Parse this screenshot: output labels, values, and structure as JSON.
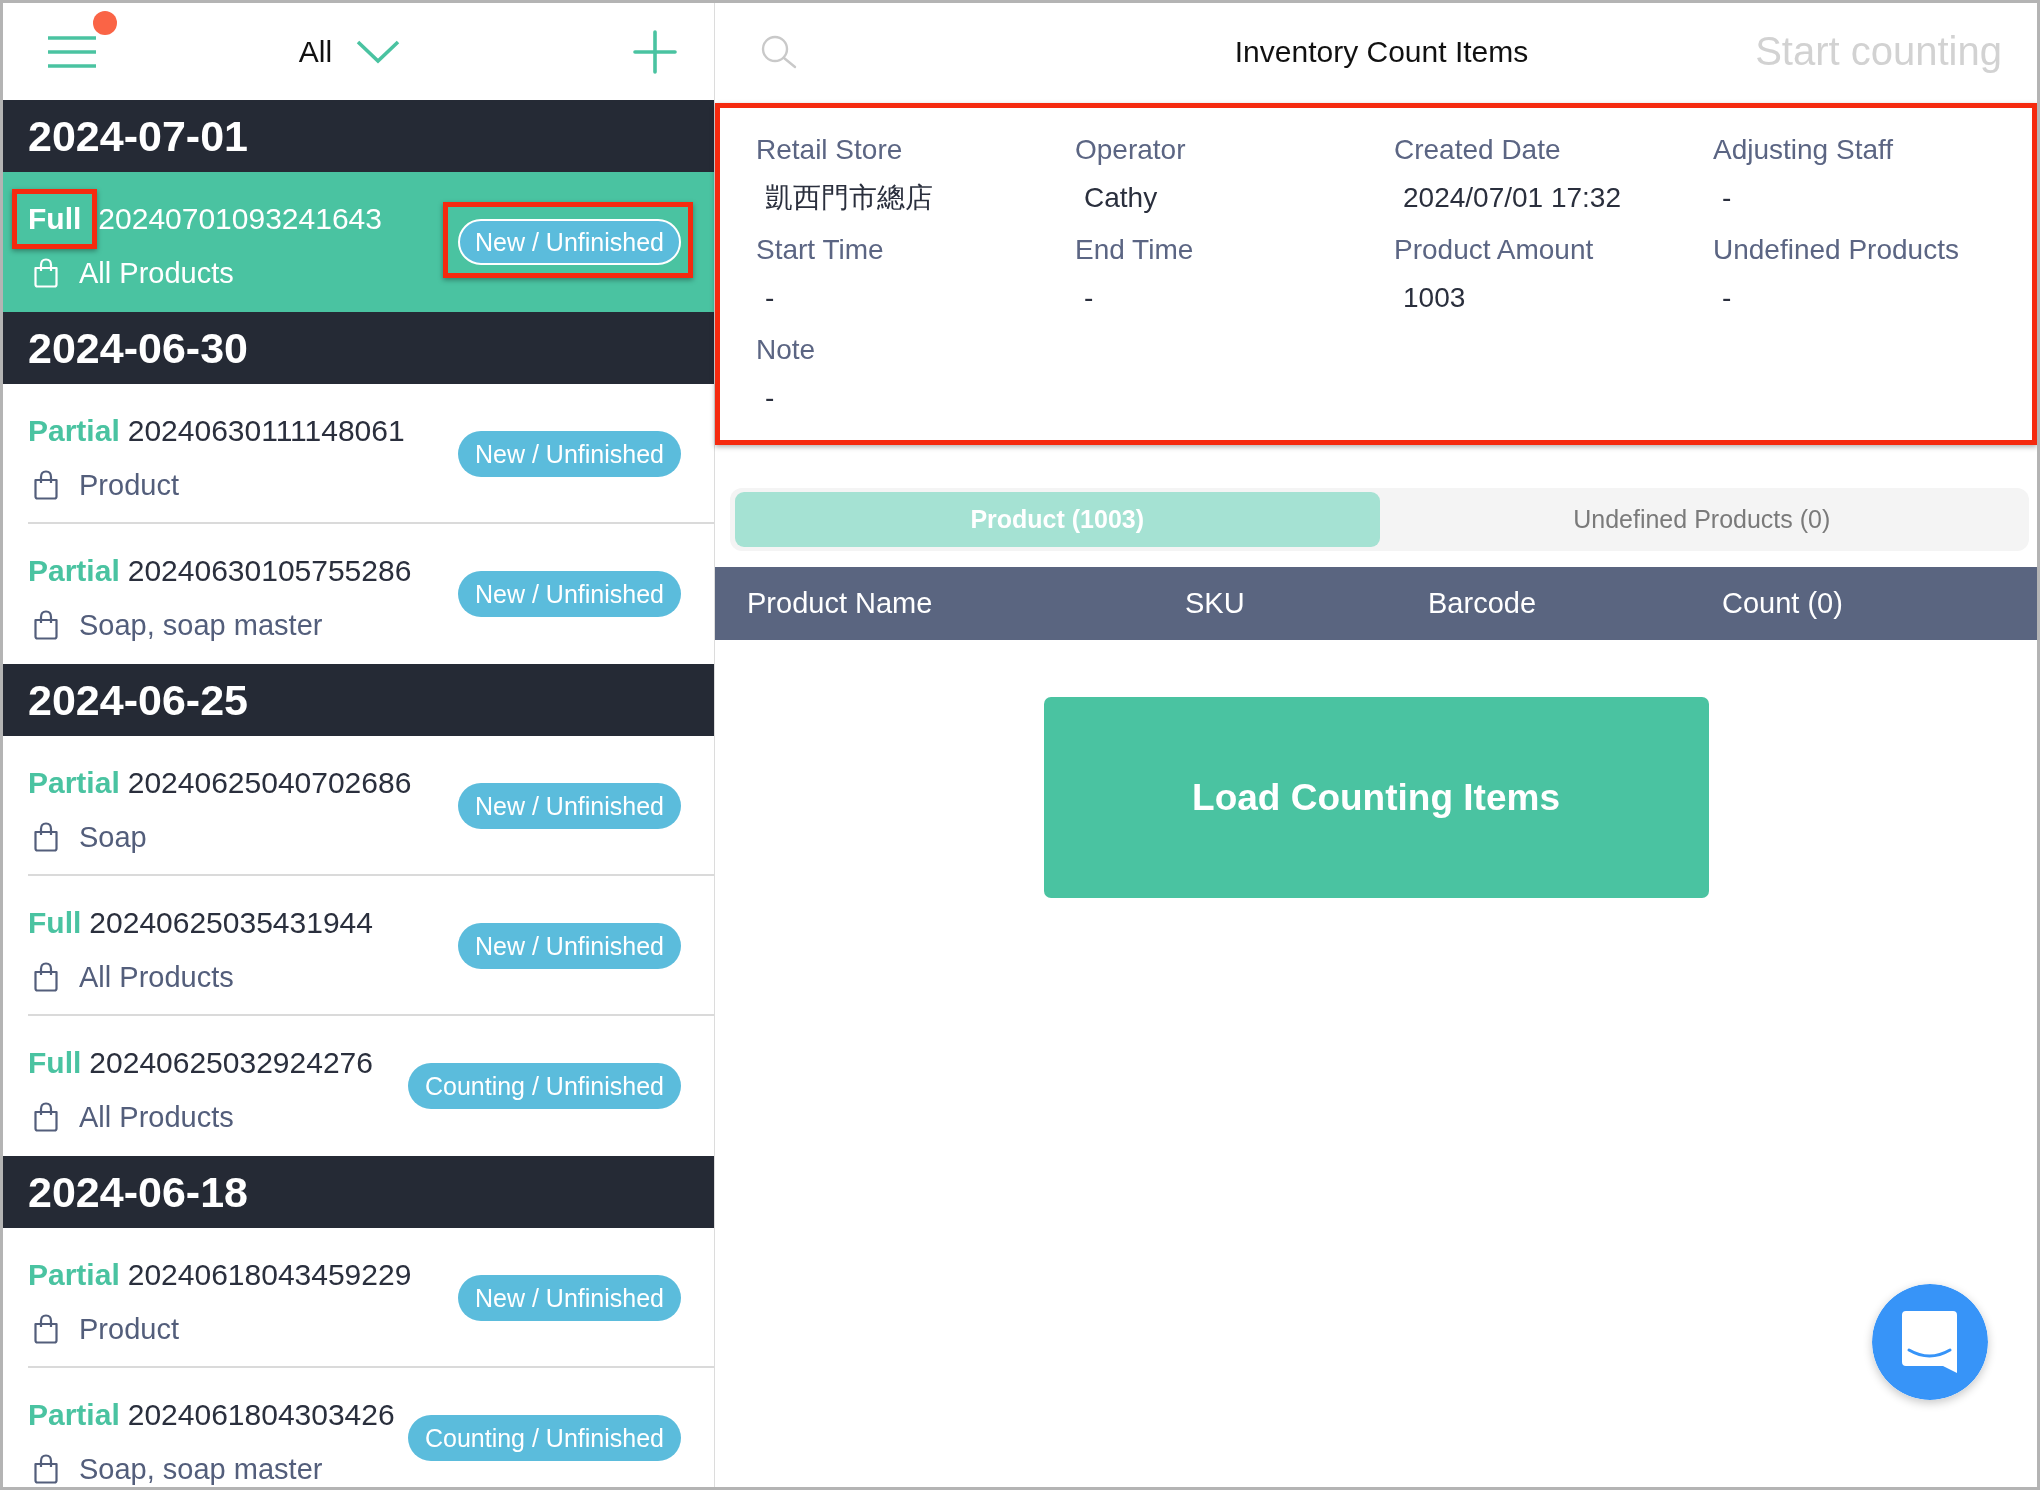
{
  "sidebar": {
    "menu": {
      "notification": true
    },
    "filter": {
      "label": "All"
    },
    "groups": [
      {
        "date": "2024-07-01",
        "items": [
          {
            "type": "Full",
            "number": "20240701093241643",
            "scope": "All Products",
            "status": "New / Unfinished",
            "selected": true,
            "type_highlighted": true,
            "status_highlighted": true
          }
        ]
      },
      {
        "date": "2024-06-30",
        "items": [
          {
            "type": "Partial",
            "number": "20240630111148061",
            "scope": "Product",
            "status": "New / Unfinished",
            "selected": false,
            "type_highlighted": false,
            "status_highlighted": false
          },
          {
            "type": "Partial",
            "number": "20240630105755286",
            "scope": "Soap, soap master",
            "status": "New / Unfinished",
            "selected": false,
            "type_highlighted": false,
            "status_highlighted": false
          }
        ]
      },
      {
        "date": "2024-06-25",
        "items": [
          {
            "type": "Partial",
            "number": "20240625040702686",
            "scope": "Soap",
            "status": "New / Unfinished",
            "selected": false,
            "type_highlighted": false,
            "status_highlighted": false
          },
          {
            "type": "Full",
            "number": "20240625035431944",
            "scope": "All Products",
            "status": "New / Unfinished",
            "selected": false,
            "type_highlighted": false,
            "status_highlighted": false
          },
          {
            "type": "Full",
            "number": "20240625032924276",
            "scope": "All Products",
            "status": "Counting / Unfinished",
            "selected": false,
            "type_highlighted": false,
            "status_highlighted": false
          }
        ]
      },
      {
        "date": "2024-06-18",
        "items": [
          {
            "type": "Partial",
            "number": "20240618043459229",
            "scope": "Product",
            "status": "New / Unfinished",
            "selected": false,
            "type_highlighted": false,
            "status_highlighted": false
          },
          {
            "type": "Partial",
            "number": "2024061804303426",
            "scope": "Soap, soap master",
            "status": "Counting / Unfinished",
            "selected": false,
            "type_highlighted": false,
            "status_highlighted": false
          }
        ]
      }
    ]
  },
  "detail": {
    "title": "Inventory Count Items",
    "start_button": {
      "label": "Start counting",
      "disabled": true
    },
    "info": {
      "highlighted": true,
      "fields": [
        {
          "label": "Retail Store",
          "value": "凱西門市總店"
        },
        {
          "label": "Operator",
          "value": "Cathy"
        },
        {
          "label": "Created Date",
          "value": "2024/07/01 17:32"
        },
        {
          "label": "Adjusting Staff",
          "value": "-"
        },
        {
          "label": "Start Time",
          "value": "-"
        },
        {
          "label": "End Time",
          "value": "-"
        },
        {
          "label": "Product Amount",
          "value": "1003"
        },
        {
          "label": "Undefined Products",
          "value": "-"
        },
        {
          "label": "Note",
          "value": "-"
        }
      ]
    },
    "tabs": [
      {
        "label": "Product (1003)",
        "selected": true
      },
      {
        "label": "Undefined Products (0)",
        "selected": false
      }
    ],
    "table": {
      "columns": [
        "Product Name",
        "SKU",
        "Barcode",
        "Count (0)"
      ]
    },
    "load_button": {
      "label": "Load Counting Items"
    }
  }
}
